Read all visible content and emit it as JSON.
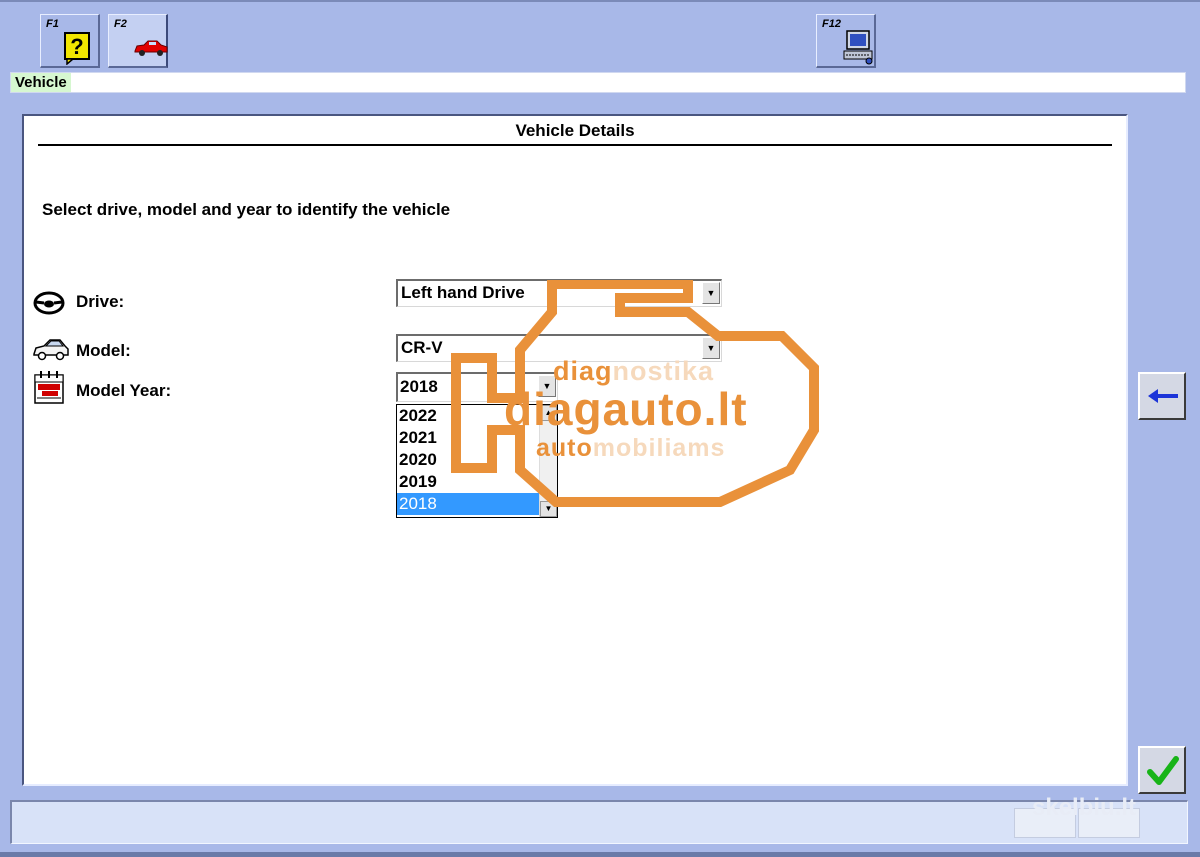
{
  "toolbar": {
    "keys": [
      {
        "label": "F1",
        "icon": "help-icon"
      },
      {
        "label": "F2",
        "icon": "car-icon"
      },
      {
        "label": "F12",
        "icon": "computer-network-icon"
      }
    ]
  },
  "breadcrumb": {
    "item": "Vehicle"
  },
  "panel": {
    "title": "Vehicle Details",
    "instruction": "Select drive, model and year to identify the vehicle",
    "drive": {
      "label": "Drive:",
      "value": "Left hand Drive",
      "icon": "steering-wheel-icon"
    },
    "model": {
      "label": "Model:",
      "value": "CR-V",
      "icon": "car-outline-icon"
    },
    "model_year": {
      "label": "Model Year:",
      "value": "2018",
      "icon": "calendar-icon",
      "options": [
        "2022",
        "2021",
        "2020",
        "2019",
        "2018"
      ],
      "selected": "2018"
    }
  },
  "watermark": {
    "line1a": "diag",
    "line1b": "nostika",
    "line2": "diagauto.lt",
    "line3a": "auto",
    "line3b": "mobiliams",
    "corner": "skelbiu.lt"
  },
  "colors": {
    "background": "#a8b8e8",
    "selection": "#3399ff",
    "breadcrumb_bg": "#d6f7d0",
    "watermark": "#e9913a"
  },
  "side_buttons": {
    "back": "back-arrow-icon",
    "confirm": "checkmark-icon"
  }
}
